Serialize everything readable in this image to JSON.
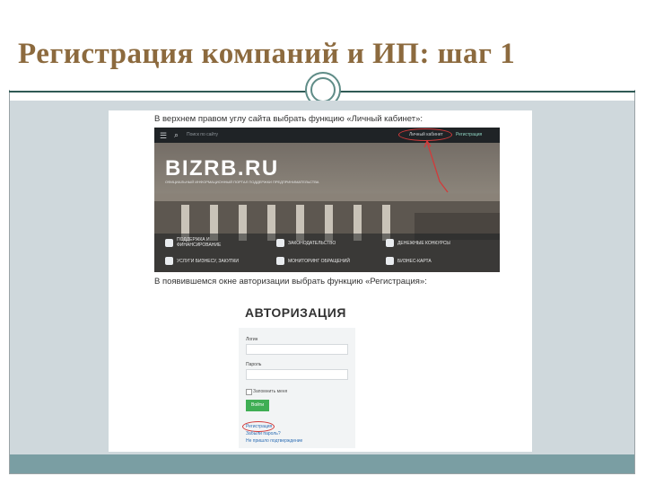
{
  "slide": {
    "title": "Регистрация компаний и ИП: шаг 1"
  },
  "doc": {
    "caption1": "В верхнем правом углу сайта выбрать функцию «Личный кабинет»:",
    "caption2": "В появившемся окне авторизации выбрать функцию «Регистрация»:"
  },
  "site": {
    "search_placeholder": "Поиск по сайту",
    "cabinet_link": "Личный кабинет",
    "register_link": "Регистрация",
    "logo": "BIZRB.RU",
    "logo_sub": "ОФИЦИАЛЬНЫЙ ИНФОРМАЦИОННЫЙ ПОРТАЛ ПОДДЕРЖКИ ПРЕДПРИНИМАТЕЛЬСТВА",
    "cards": [
      "ПОДДЕРЖКА И ФИНАНСИРОВАНИЕ",
      "ЗАКОНОДАТЕЛЬСТВО",
      "ДЕНЕЖНЫЕ КОНКУРСЫ",
      "УСЛУГИ БИЗНЕСУ, ЗАКУПКИ",
      "МОНИТОРИНГ ОБРАЩЕНИЙ",
      "БИЗНЕС-КАРТА"
    ]
  },
  "auth": {
    "title": "АВТОРИЗАЦИЯ",
    "login_label": "Логин",
    "password_label": "Пароль",
    "remember_label": "Запомнить меня",
    "submit_label": "Войти",
    "register_link": "Регистрация",
    "forgot_link": "Забыли пароль?",
    "no_confirm_link": "Не пришло подтверждение"
  },
  "colors": {
    "title": "#8c6a3e",
    "accent": "#2f5a55",
    "annotation": "#d23a3a",
    "button": "#3fae54"
  }
}
